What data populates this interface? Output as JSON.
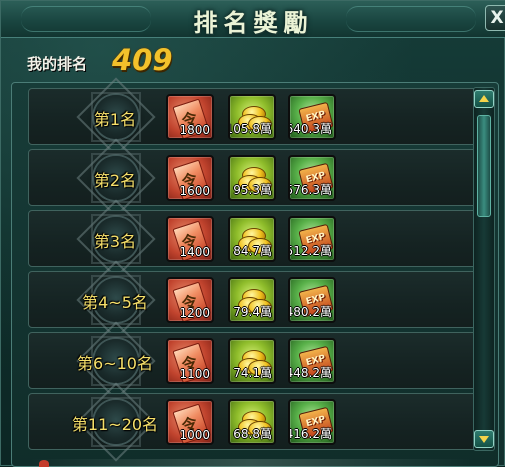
{
  "window": {
    "title": "排名獎勵",
    "close_label": "X"
  },
  "my_rank": {
    "label": "我的排名",
    "value": "409"
  },
  "rewards": [
    {
      "rank": "第1名",
      "order": "1800",
      "coins": "105.8萬",
      "exp": "640.3萬"
    },
    {
      "rank": "第2名",
      "order": "1600",
      "coins": "95.3萬",
      "exp": "576.3萬"
    },
    {
      "rank": "第3名",
      "order": "1400",
      "coins": "84.7萬",
      "exp": "512.2萬"
    },
    {
      "rank": "第4~5名",
      "order": "1200",
      "coins": "79.4萬",
      "exp": "480.2萬"
    },
    {
      "rank": "第6~10名",
      "order": "1100",
      "coins": "74.1萬",
      "exp": "448.2萬"
    },
    {
      "rank": "第11~20名",
      "order": "1000",
      "coins": "68.8萬",
      "exp": "416.2萬"
    }
  ],
  "icons": {
    "order": "command-token-icon",
    "coins": "gold-coins-icon",
    "exp": "exp-scroll-icon"
  },
  "exp_icon_text": "EXP",
  "colors": {
    "rank_value": "#f3c12b",
    "badge_text": "#f6e06a"
  }
}
